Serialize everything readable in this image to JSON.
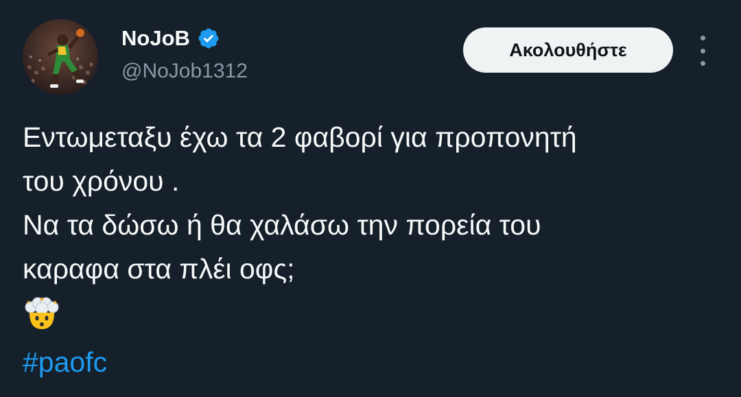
{
  "user": {
    "display_name": "NoJoB",
    "handle": "@NoJob1312",
    "verified_icon": "verified-badge-icon",
    "avatar": "player-dunking-photo"
  },
  "actions": {
    "follow_label": "Ακολουθήστε",
    "more_icon": "more-options-icon"
  },
  "tweet": {
    "lines": [
      "Εντωμεταξυ έχω τα 2 φαβορί για προπονητή",
      "του χρόνου .",
      "Να τα δώσω ή θα χαλάσω την πορεία του",
      "καραφα στα πλέι οφς;"
    ],
    "emoji": "exploding-head-emoji",
    "hashtag": "#paofc"
  },
  "colors": {
    "background": "#15202b",
    "text": "#f7f9f9",
    "secondary": "#8b98a5",
    "accent": "#1d9bf0",
    "button_bg": "#eff3f4"
  }
}
